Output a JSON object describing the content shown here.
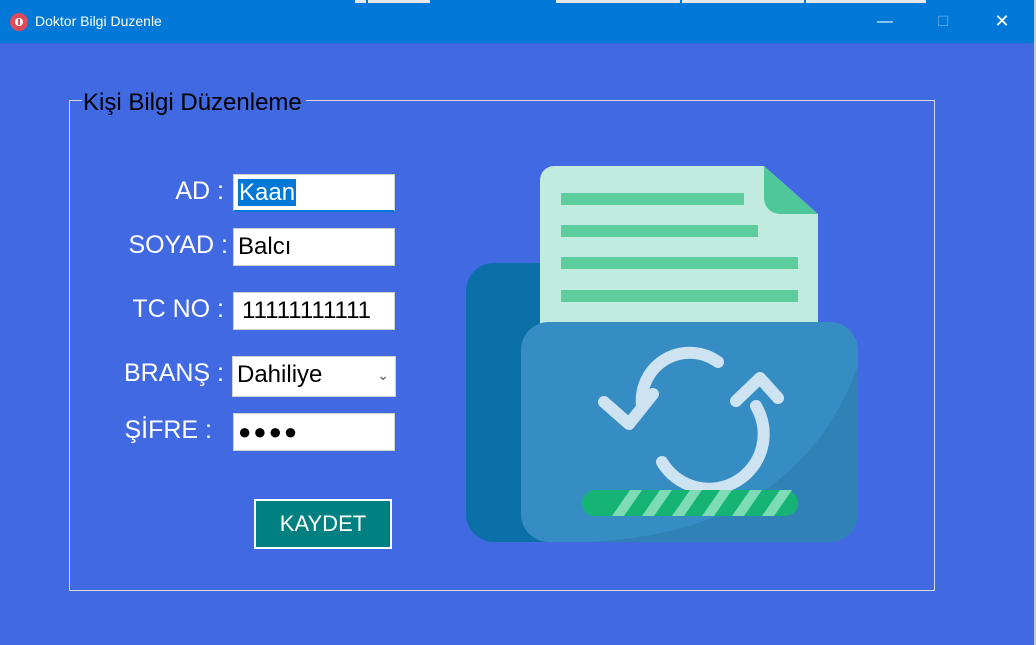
{
  "window": {
    "title": "Doktor Bilgi Duzenle",
    "controls": {
      "minimize": "—",
      "maximize": "☐",
      "close": "✕"
    }
  },
  "group": {
    "legend": "Kişi Bilgi Düzenleme"
  },
  "form": {
    "ad": {
      "label": "AD :",
      "value": "Kaan"
    },
    "soyad": {
      "label": "SOYAD :",
      "value": "Balcı"
    },
    "tc": {
      "label": "TC NO :",
      "value": "11111111111"
    },
    "brans": {
      "label": "BRANŞ :",
      "value": "Dahiliye"
    },
    "sifre": {
      "label": "ŞİFRE :",
      "value": "●●●●"
    }
  },
  "actions": {
    "save_label": "KAYDET"
  },
  "illustration": {
    "icon": "folder-sync-icon",
    "colors": {
      "folder_back": "#0b6fa8",
      "folder_front": "#358dc3",
      "paper": "#c1ebdf",
      "paper_lines": "#5ecd9e",
      "progress": "#15b374"
    }
  }
}
